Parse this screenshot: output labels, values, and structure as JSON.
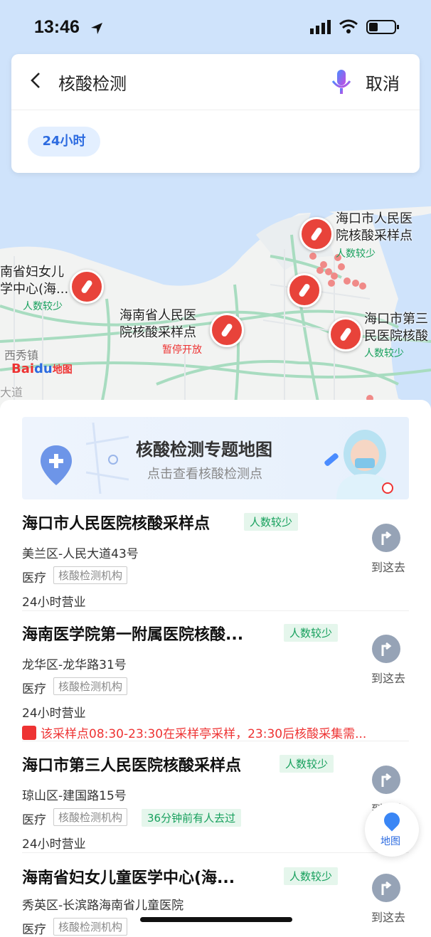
{
  "status_bar": {
    "time": "13:46"
  },
  "search": {
    "query": "核酸检测",
    "cancel_label": "取消",
    "filter_chip": "24小时"
  },
  "map": {
    "logo_text": "Bai",
    "logo_paw": "du",
    "logo_suffix": "地图",
    "place_label": "西秀镇",
    "place_label2": "大道",
    "pins": [
      {
        "label_line1": "海口市人民医",
        "label_line2": "院核酸采样点",
        "sub": "人数较少"
      },
      {
        "label_line1": "南省妇女儿",
        "label_line2": "学中心(海...",
        "sub": "人数较少"
      },
      {
        "label_line1": "海南省人民医",
        "label_line2": "院核酸采样点",
        "sub": "暂停开放"
      },
      {
        "label_line1": "海口市第三",
        "label_line2": "民医院核酸",
        "sub": "人数较少"
      }
    ]
  },
  "banner": {
    "title": "核酸检测专题地图",
    "subtitle": "点击查看核酸检测点"
  },
  "results": [
    {
      "name": "海口市人民医院核酸采样点",
      "badge": "人数较少",
      "address": "美兰区-人民大道43号",
      "category": "医疗",
      "category_tag": "核酸检测机构",
      "hours": "24小时营业",
      "action": "到这去"
    },
    {
      "name": "海南医学院第一附属医院核酸...",
      "badge": "人数较少",
      "address": "龙华区-龙华路31号",
      "category": "医疗",
      "category_tag": "核酸检测机构",
      "hours": "24小时营业",
      "notice": "该采样点08:30-23:30在采样亭采样，23:30后核酸采集需...",
      "action": "到这去"
    },
    {
      "name": "海口市第三人民医院核酸采样点",
      "badge": "人数较少",
      "address": "琼山区-建国路15号",
      "category": "医疗",
      "category_tag": "核酸检测机构",
      "extra_tag": "36分钟前有人去过",
      "hours": "24小时营业",
      "action": "到这去"
    },
    {
      "name": "海南省妇女儿童医学中心(海...",
      "badge": "人数较少",
      "address": "秀英区-长滨路海南省儿童医院",
      "category": "医疗",
      "category_tag": "核酸检测机构",
      "action": "到这去"
    }
  ],
  "map_button_label": "地图",
  "colors": {
    "accent": "#2c6be0",
    "pin_red": "#e8433a",
    "green": "#17a05d",
    "alert_red": "#e33333"
  }
}
